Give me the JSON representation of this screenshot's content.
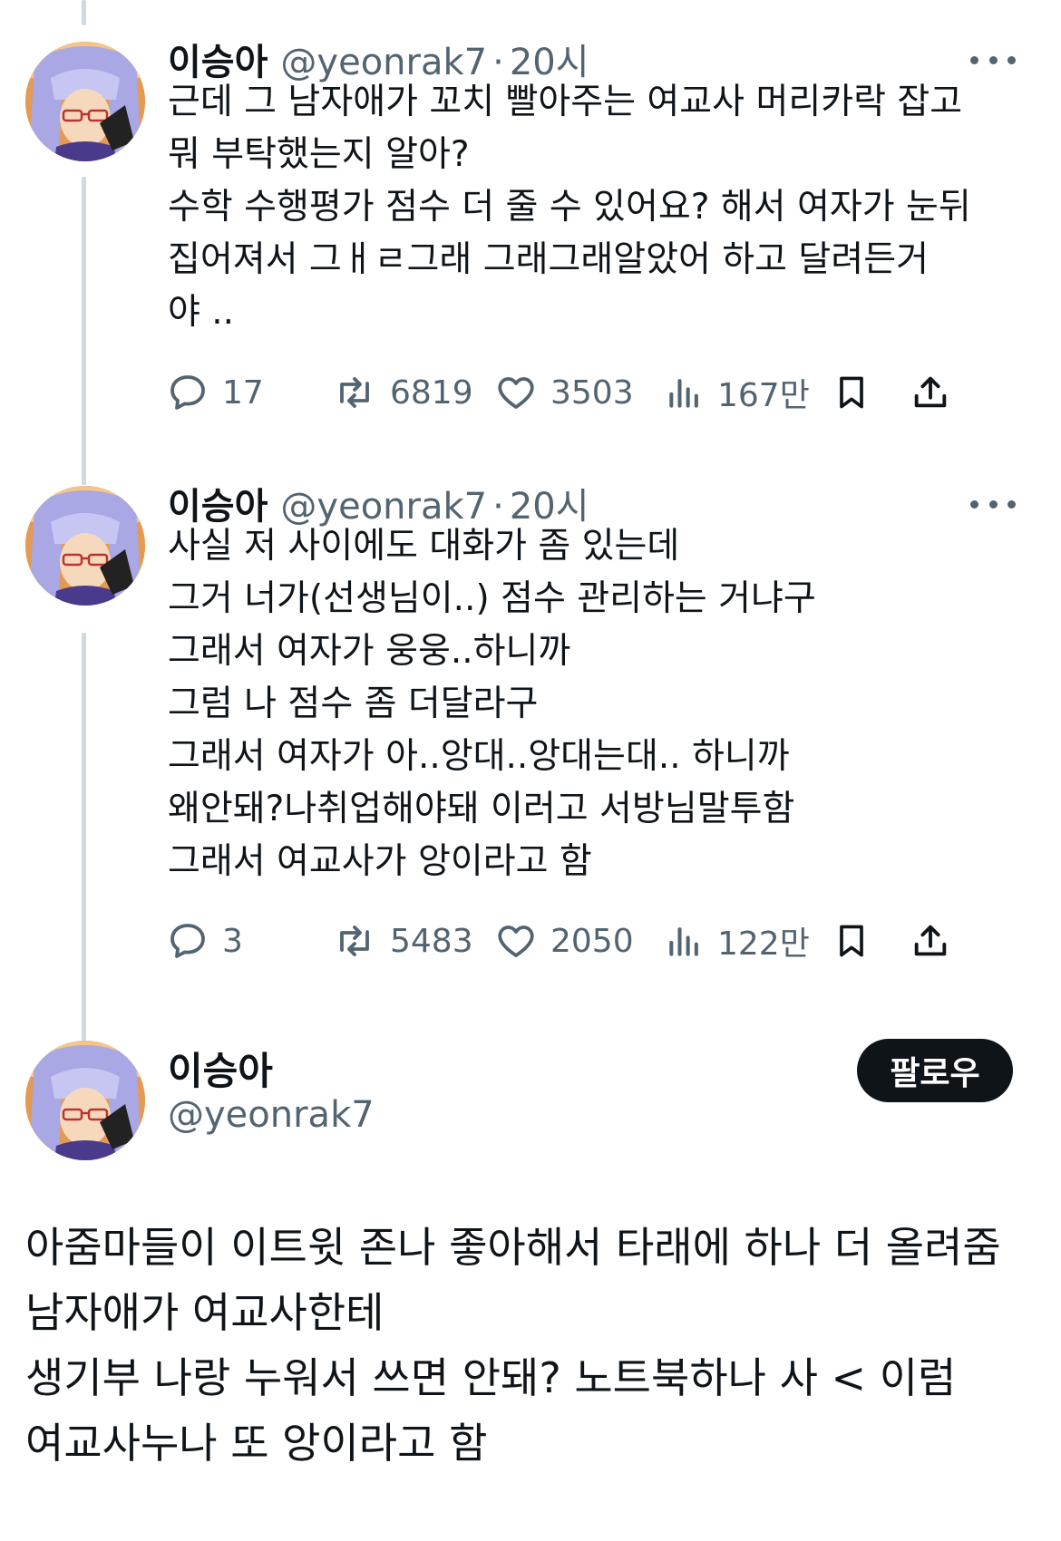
{
  "tweets": [
    {
      "author": "이승아",
      "handle": "@yeonrak7",
      "separator": "·",
      "time": "20시",
      "lines": [
        "근데 그 남자애가 꼬치 빨아주는 여교사 머리카락 잡고",
        "뭐 부탁했는지 알아?",
        "수학 수행평가 점수 더 줄 수 있어요? 해서 여자가 눈뒤",
        "집어져서 그ㅐㄹ그래 그래그래알았어 하고 달려든거",
        "야 .."
      ],
      "replies": "17",
      "retweets": "6819",
      "likes": "3503",
      "views": "167만"
    },
    {
      "author": "이승아",
      "handle": "@yeonrak7",
      "separator": "·",
      "time": "20시",
      "lines": [
        "사실 저 사이에도 대화가 좀 있는데",
        "그거 너가(선생님이..) 점수 관리하는 거냐구",
        "그래서 여자가 웅웅..하니까",
        "그럼 나 점수 좀 더달라구",
        "그래서 여자가 아..앙대..앙대는대.. 하니까",
        "왜안돼?나취업해야돼 이러고 서방님말투함",
        "그래서 여교사가 앙이라고 함"
      ],
      "replies": "3",
      "retweets": "5483",
      "likes": "2050",
      "views": "122만"
    }
  ],
  "main_post": {
    "author": "이승아",
    "handle": "@yeonrak7",
    "follow_label": "팔로우",
    "lines": [
      "아줌마들이 이트윗 존나 좋아해서 타래에 하나 더 올려줌",
      "남자애가 여교사한테",
      "생기부 나랑 누워서 쓰면 안돼? 노트북하나 사 < 이럼",
      "여교사누나 또 앙이라고 함"
    ]
  },
  "icons": {
    "more": "more-dots-icon",
    "reply": "reply-bubble-icon",
    "retweet": "retweet-icon",
    "like": "heart-icon",
    "views": "bar-chart-icon",
    "bookmark": "bookmark-icon",
    "share": "share-upload-icon"
  },
  "colors": {
    "text": "#0f1419",
    "secondary": "#536471",
    "thread_line": "#cfd9de",
    "follow_button": "#0f1419"
  }
}
